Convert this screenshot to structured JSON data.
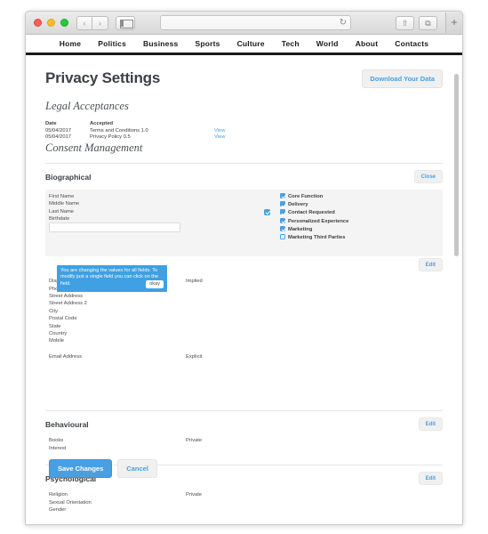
{
  "browser": {
    "traffic_lights": [
      "close",
      "minimize",
      "zoom"
    ],
    "back_label": "‹",
    "forward_label": "›",
    "address_value": "",
    "reload_label": "↻",
    "share_label": "⇧",
    "tabs_label": "⧉",
    "new_tab_label": "+"
  },
  "site_nav": {
    "items": [
      "Home",
      "Politics",
      "Business",
      "Sports",
      "Culture",
      "Tech",
      "World",
      "About",
      "Contacts"
    ]
  },
  "page": {
    "title": "Privacy Settings",
    "download_button": "Download Your Data",
    "legal_heading": "Legal Acceptances",
    "consent_heading": "Consent Management"
  },
  "legal": {
    "headers": [
      "Date",
      "Accepted",
      ""
    ],
    "rows": [
      {
        "date": "05/04/2017",
        "accepted": "Terms and Conditions 1.0",
        "view": "View"
      },
      {
        "date": "05/04/2017",
        "accepted": "Privacy Policy 0.5",
        "view": "View"
      }
    ]
  },
  "biographical": {
    "title": "Biographical",
    "close_button": "Close",
    "edit_button": "Edit",
    "group1_fields": [
      "First Name",
      "Middle Name",
      "Last Name",
      "Birthdate"
    ],
    "group1_master_checked": true,
    "consent_options": [
      {
        "label": "Core Function",
        "checked": true
      },
      {
        "label": "Delivery",
        "checked": true
      },
      {
        "label": "Contact Requested",
        "checked": true
      },
      {
        "label": "Personalized Experience",
        "checked": true
      },
      {
        "label": "Marketing",
        "checked": true
      },
      {
        "label": "Marketing Third Parties",
        "checked": false
      }
    ],
    "group2_fields": [
      "Display Name",
      "Phone",
      "Street Address",
      "Street Address 2",
      "City",
      "Postal Code",
      "State",
      "Country",
      "Mobile"
    ],
    "group2_value": "Implied",
    "group3_fields": [
      "Email Address"
    ],
    "group3_value": "Explicit"
  },
  "behavioural": {
    "title": "Behavioural",
    "edit_button": "Edit",
    "fields": [
      "Books",
      "Interest"
    ],
    "value": "Private"
  },
  "psychological": {
    "title": "Psychological",
    "edit_button": "Edit",
    "fields": [
      "Religion",
      "Sexual Orientation",
      "Gender"
    ],
    "value": "Private"
  },
  "tooltip": {
    "text": "You are changing the values for all fields. To modify just a single field you can click on the field.",
    "button": "okay"
  },
  "footer": {
    "save_label": "Save Changes",
    "cancel_label": "Cancel"
  },
  "colors": {
    "accent": "#4a9fe0",
    "tooltip_bg": "#3fa0e3",
    "title": "#3b4146",
    "row_highlight": "#f4f4f4"
  }
}
